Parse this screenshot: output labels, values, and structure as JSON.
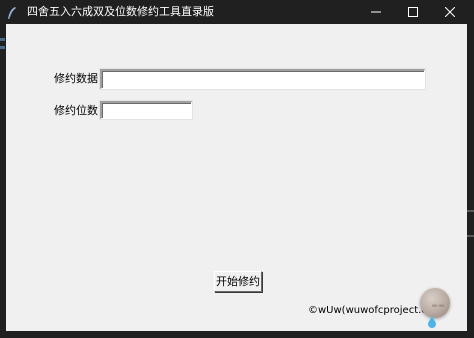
{
  "window": {
    "title": "四舍五入六成双及位数修约工具直录版"
  },
  "form": {
    "data_label": "修约数据:",
    "data_value": "",
    "digits_label": "修约位数:",
    "digits_value": ""
  },
  "actions": {
    "start_label": "开始修约"
  },
  "footer": {
    "copyright": "©wUw(wuwofcproject.com)"
  },
  "overlay": {
    "ball_text": "wk-wk"
  },
  "colors": {
    "titlebar": "#202020",
    "client_bg": "#f0f0f0",
    "title_text": "#ffffff"
  },
  "icons": [
    "feather-icon",
    "minimize-icon",
    "maximize-icon",
    "close-icon"
  ]
}
